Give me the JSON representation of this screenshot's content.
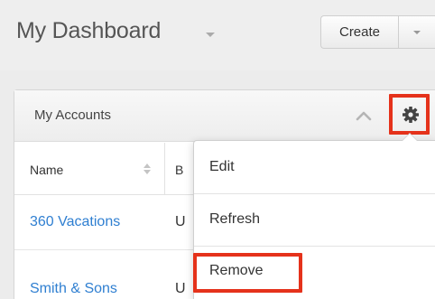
{
  "header": {
    "title": "My Dashboard",
    "create_label": "Create"
  },
  "dashlet": {
    "title": "My Accounts",
    "columns": [
      "Name",
      "B"
    ],
    "rows": [
      {
        "name": "360 Vacations",
        "col2": "U"
      },
      {
        "name": "Smith & Sons",
        "col2": "U"
      }
    ]
  },
  "menu": {
    "items": [
      "Edit",
      "Refresh",
      "Remove"
    ]
  },
  "icons": {
    "title_caret": "chevron-down-icon",
    "create_caret": "chevron-down-icon",
    "collapse": "chevron-up-icon",
    "settings": "gear-icon",
    "sort": "sort-icon"
  },
  "colors": {
    "highlight": "#e5321b",
    "link": "#2f7fd1"
  }
}
